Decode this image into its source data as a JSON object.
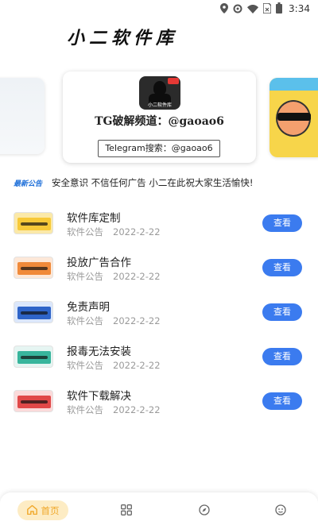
{
  "status_bar": {
    "time": "3:34",
    "icons": [
      "location-icon",
      "settings-icon",
      "wifi-icon",
      "sim-icon",
      "battery-icon"
    ]
  },
  "app": {
    "title": "小二软件库"
  },
  "banner": {
    "logo_text": "小二软件库",
    "line1": "TG破解频道：@gaoao6",
    "line2": "Telegram搜索：@gaoao6"
  },
  "notice": {
    "tag": "最新公告",
    "text": "安全意识  不信任何广告  小二在此祝大家生活愉快!"
  },
  "list": {
    "items": [
      {
        "title": "软件库定制",
        "category": "软件公告",
        "date": "2022-2-22",
        "button": "查看",
        "thumb_bg": "#fbe9a8",
        "thumb_inner": "#f7c938"
      },
      {
        "title": "投放广告合作",
        "category": "软件公告",
        "date": "2022-2-22",
        "button": "查看",
        "thumb_bg": "#fde8d8",
        "thumb_inner": "#f08a3a"
      },
      {
        "title": "免责声明",
        "category": "软件公告",
        "date": "2022-2-22",
        "button": "查看",
        "thumb_bg": "#dbe7fb",
        "thumb_inner": "#2e64c8"
      },
      {
        "title": "报毒无法安装",
        "category": "软件公告",
        "date": "2022-2-22",
        "button": "查看",
        "thumb_bg": "#e6f5f2",
        "thumb_inner": "#38b59c"
      },
      {
        "title": "软件下载解决",
        "category": "软件公告",
        "date": "2022-2-22",
        "button": "查看",
        "thumb_bg": "#fbdada",
        "thumb_inner": "#e04848"
      }
    ]
  },
  "bottom_nav": {
    "home_label": "首页",
    "items": [
      "home-icon",
      "grid-icon",
      "compass-icon",
      "profile-icon"
    ]
  },
  "colors": {
    "accent": "#3b7bef",
    "home_active_bg": "#fdecc4",
    "home_active_fg": "#f0a92c",
    "notice_tag": "#1e6fd9"
  }
}
